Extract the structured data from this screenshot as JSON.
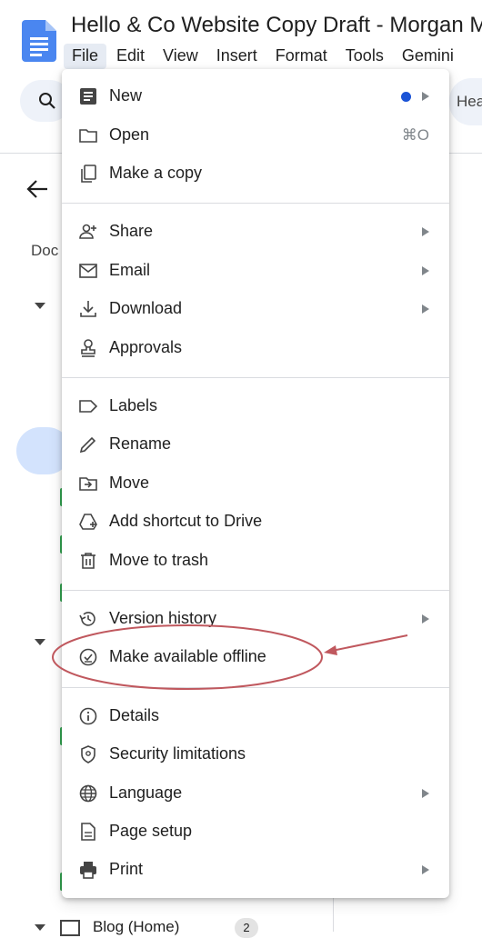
{
  "document": {
    "title": "Hello & Co Website Copy Draft - Morgan M"
  },
  "menubar": {
    "items": [
      "File",
      "Edit",
      "View",
      "Insert",
      "Format",
      "Tools",
      "Gemini"
    ],
    "active": "File"
  },
  "toolbar": {
    "style_fragment": "Hea"
  },
  "outline": {
    "doc_label_fragment": "Doc",
    "blog_item": "Blog (Home)",
    "blog_count": "2"
  },
  "file_menu": {
    "groups": [
      [
        {
          "label": "New",
          "icon": "new-doc-icon",
          "submenu": true,
          "dot": true
        },
        {
          "label": "Open",
          "icon": "folder-icon",
          "shortcut": "⌘O"
        },
        {
          "label": "Make a copy",
          "icon": "copy-icon"
        }
      ],
      [
        {
          "label": "Share",
          "icon": "person-add-icon",
          "submenu": true
        },
        {
          "label": "Email",
          "icon": "mail-icon",
          "submenu": true
        },
        {
          "label": "Download",
          "icon": "download-icon",
          "submenu": true
        },
        {
          "label": "Approvals",
          "icon": "approval-stamp-icon"
        }
      ],
      [
        {
          "label": "Labels",
          "icon": "label-icon"
        },
        {
          "label": "Rename",
          "icon": "pencil-icon"
        },
        {
          "label": "Move",
          "icon": "move-folder-icon"
        },
        {
          "label": "Add shortcut to Drive",
          "icon": "drive-shortcut-icon"
        },
        {
          "label": "Move to trash",
          "icon": "trash-icon"
        }
      ],
      [
        {
          "label": "Version history",
          "icon": "history-icon",
          "submenu": true
        },
        {
          "label": "Make available offline",
          "icon": "offline-check-icon",
          "highlighted": true
        }
      ],
      [
        {
          "label": "Details",
          "icon": "info-icon"
        },
        {
          "label": "Security limitations",
          "icon": "shield-icon"
        },
        {
          "label": "Language",
          "icon": "globe-icon",
          "submenu": true
        },
        {
          "label": "Page setup",
          "icon": "page-icon"
        },
        {
          "label": "Print",
          "icon": "printer-icon",
          "submenu": true
        }
      ]
    ]
  },
  "colors": {
    "annotation": "#c0585e",
    "accent_dot": "#1a53d6",
    "doc_icon": "#4a86f0"
  }
}
